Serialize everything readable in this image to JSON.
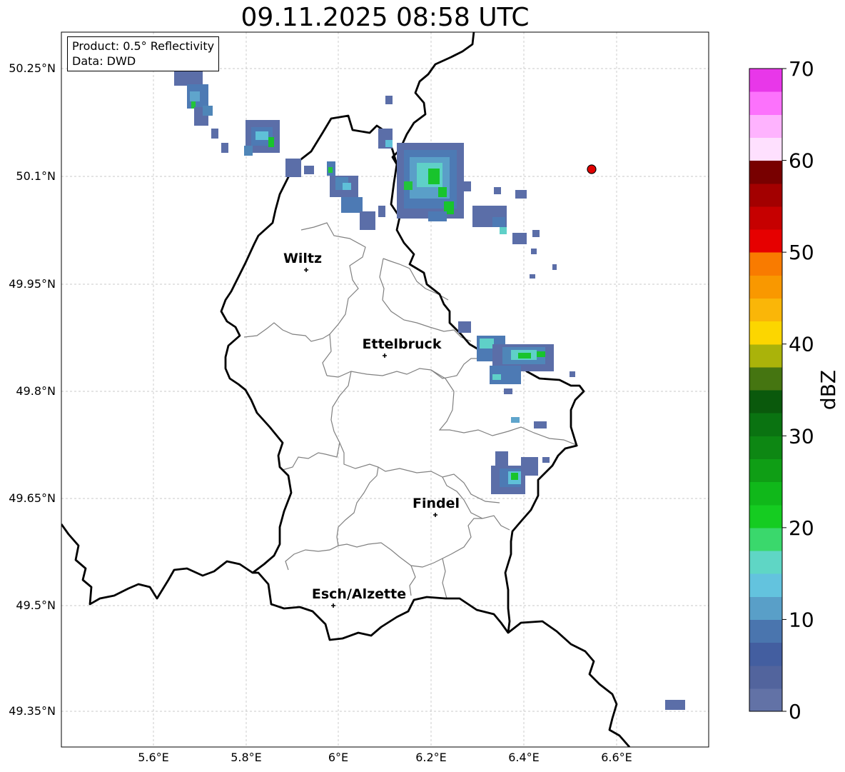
{
  "title": "09.11.2025 08:58 UTC",
  "info": {
    "product": "Product: 0.5° Reflectivity",
    "data": "Data: DWD"
  },
  "axes": {
    "lat_ticks": [
      "50.25°N",
      "50.1°N",
      "49.95°N",
      "49.8°N",
      "49.65°N",
      "49.5°N",
      "49.35°N"
    ],
    "lon_ticks": [
      "5.6°E",
      "5.8°E",
      "6°E",
      "6.2°E",
      "6.4°E",
      "6.6°E"
    ]
  },
  "cities": [
    {
      "name": "Wiltz",
      "lon": 5.932,
      "lat": 49.966
    },
    {
      "name": "Ettelbruck",
      "lon": 6.104,
      "lat": 49.848
    },
    {
      "name": "Findel",
      "lon": 6.209,
      "lat": 49.626
    },
    {
      "name": "Esch/Alzette",
      "lon": 5.99,
      "lat": 49.498
    }
  ],
  "radar_site": {
    "lon": 6.548,
    "lat": 50.109,
    "color": "#e10000"
  },
  "colorbar": {
    "label": "dBZ",
    "ticks": [
      "0",
      "10",
      "20",
      "30",
      "40",
      "50",
      "60",
      "70"
    ],
    "colors": [
      "#6272a6",
      "#52649d",
      "#435ea0",
      "#4a75ae",
      "#599fc8",
      "#63c3de",
      "#5fd6c5",
      "#3ad86c",
      "#15cc21",
      "#10b81a",
      "#0f9e15",
      "#0d8713",
      "#0a7311",
      "#0a590c",
      "#457511",
      "#aab30a",
      "#fcd600",
      "#fab608",
      "#f99800",
      "#f97b00",
      "#e60000",
      "#c60000",
      "#a30000",
      "#780000",
      "#fee0fe",
      "#feb3fe",
      "#fc72fc",
      "#e837e9"
    ]
  }
}
